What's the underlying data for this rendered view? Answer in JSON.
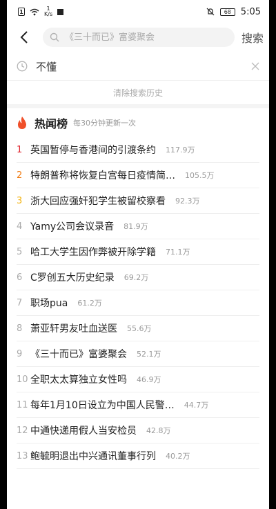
{
  "status_bar": {
    "sim_label": "1",
    "net_speed_value": "1",
    "net_speed_unit": "K/s",
    "battery": "68",
    "time": "5:05"
  },
  "search": {
    "placeholder": "《三十而已》富婆聚会",
    "button_label": "搜索"
  },
  "history": {
    "items": [
      {
        "label": "不懂"
      }
    ],
    "clear_label": "清除搜索历史"
  },
  "hot": {
    "title": "热闻榜",
    "subtitle": "每30分钟更新一次",
    "accent_color": "#f0502a",
    "items": [
      {
        "rank": "1",
        "title": "英国暂停与香港间的引渡条约",
        "count": "117.9万"
      },
      {
        "rank": "2",
        "title": "特朗普称将恢复白宫每日疫情简…",
        "count": "105.5万"
      },
      {
        "rank": "3",
        "title": "浙大回应强奸犯学生被留校察看",
        "count": "92.3万"
      },
      {
        "rank": "4",
        "title": "Yamy公司会议录音",
        "count": "81.9万"
      },
      {
        "rank": "5",
        "title": "哈工大学生因作弊被开除学籍",
        "count": "71.1万"
      },
      {
        "rank": "6",
        "title": "C罗创五大历史纪录",
        "count": "69.2万"
      },
      {
        "rank": "7",
        "title": "职场pua",
        "count": "61.2万"
      },
      {
        "rank": "8",
        "title": "萧亚轩男友吐血送医",
        "count": "55.6万"
      },
      {
        "rank": "9",
        "title": "《三十而已》富婆聚会",
        "count": "52.1万"
      },
      {
        "rank": "10",
        "title": "全职太太算独立女性吗",
        "count": "46.9万"
      },
      {
        "rank": "11",
        "title": "每年1月10日设立为中国人民警…",
        "count": "44.7万"
      },
      {
        "rank": "12",
        "title": "中通快递用假人当安检员",
        "count": "42.8万"
      },
      {
        "rank": "13",
        "title": "鲍毓明退出中兴通讯董事行列",
        "count": "40.2万"
      }
    ]
  }
}
